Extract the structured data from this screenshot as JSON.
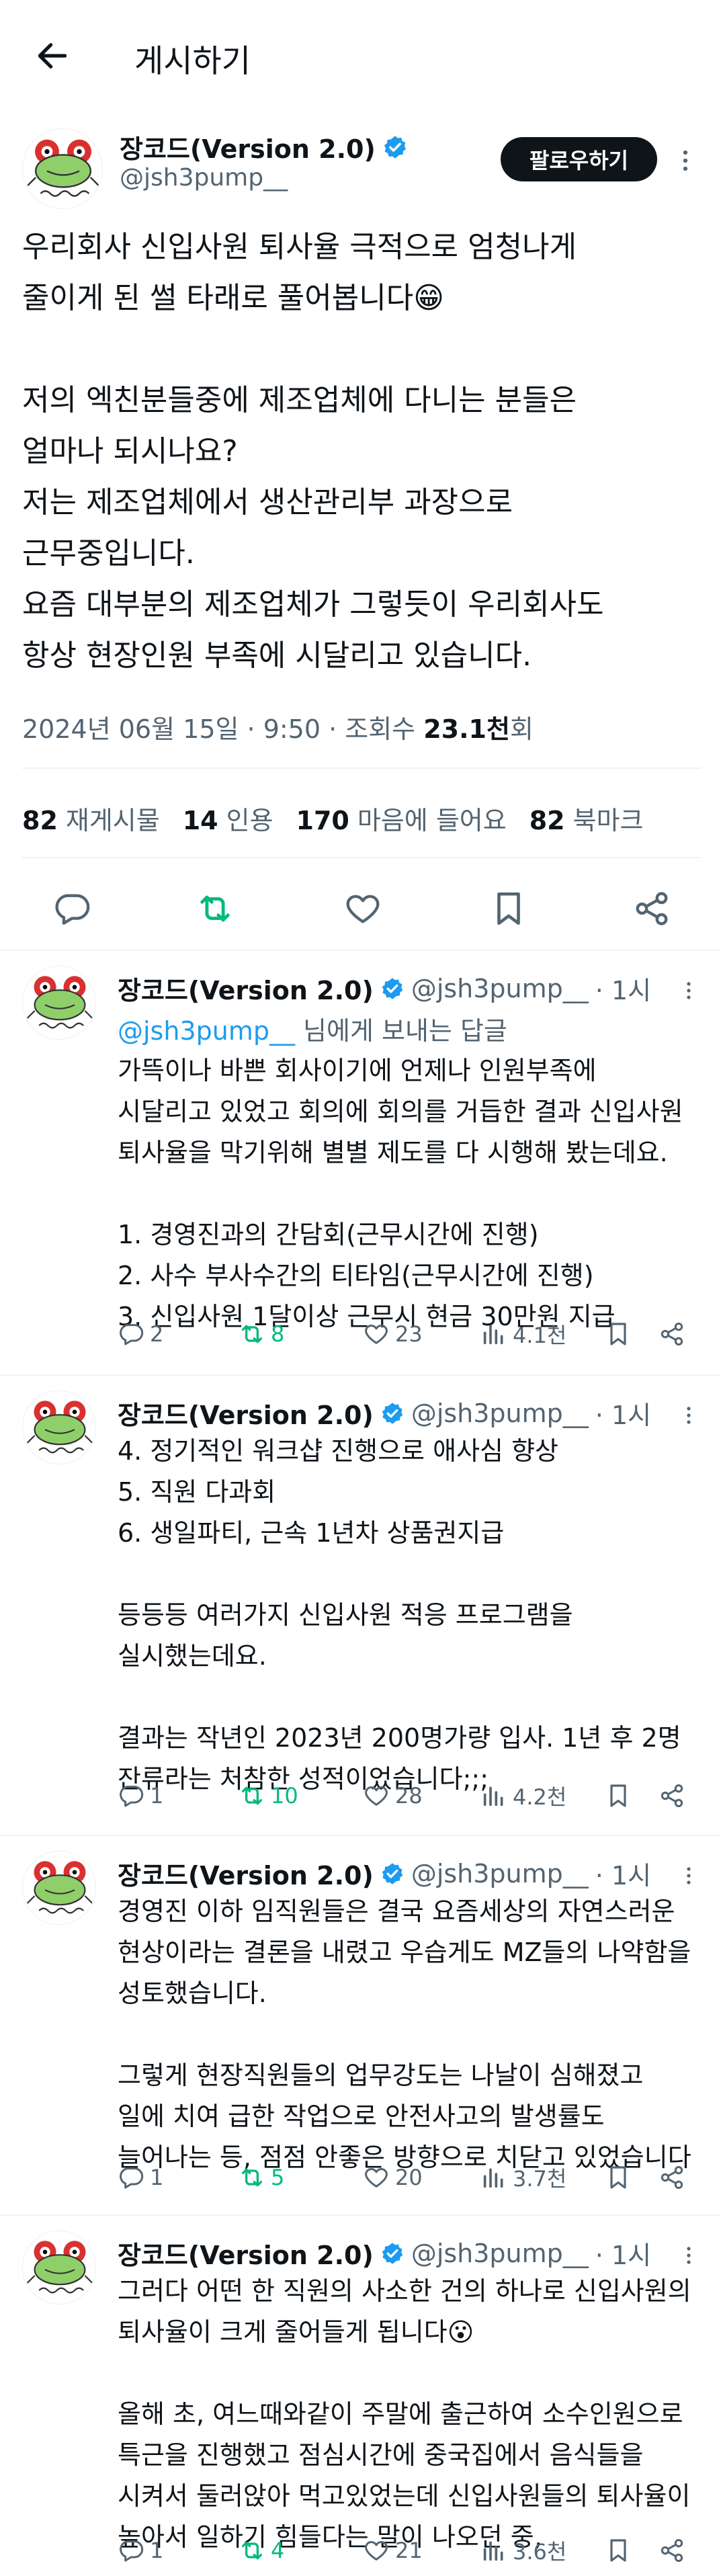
{
  "header": {
    "title": "게시하기"
  },
  "colors": {
    "accent": "#1d9bf0",
    "retweet": "#00ba7c",
    "text": "#0f1419",
    "muted": "#536471"
  },
  "post": {
    "author_name": "장코드(Version 2.0)",
    "handle": "@jsh3pump__",
    "follow_label": "팔로우하기",
    "body": "우리회사 신입사원 퇴사율 극적으로 엄청나게\n줄이게 된 썰 타래로 풀어봅니다😁\n\n저의 엑친분들중에 제조업체에 다니는 분들은\n얼마나 되시나요?\n저는 제조업체에서 생산관리부 과장으로\n근무중입니다.\n요즘 대부분의 제조업체가 그렇듯이 우리회사도\n항상 현장인원 부족에 시달리고 있습니다.",
    "meta_prefix": "2024년 06월 15일 · 9:50 · 조회수 ",
    "views": "23.1천",
    "views_suffix": "회",
    "stats": [
      {
        "count": "82",
        "label": "재게시물"
      },
      {
        "count": "14",
        "label": "인용"
      },
      {
        "count": "170",
        "label": "마음에 들어요"
      },
      {
        "count": "82",
        "label": "북마크"
      }
    ]
  },
  "replies": [
    {
      "name": "장코드(Version 2.0)",
      "handle": "@jsh3pump__",
      "time": "· 1시",
      "reply_to_handle": "@jsh3pump__",
      "reply_to_suffix": " 님에게 보내는 답글",
      "body": "가뜩이나 바쁜 회사이기에 언제나 인원부족에\n시달리고 있었고 회의에 회의를 거듭한 결과 신입사원\n퇴사율을 막기위해 별별 제도를 다 시행해 봤는데요.\n\n1. 경영진과의 간담회(근무시간에 진행)\n2. 사수 부사수간의 티타임(근무시간에 진행)\n3. 신입사원 1달이상 근무시 현금 30만원 지급",
      "replies": "2",
      "reposts": "8",
      "likes": "23",
      "views": "4.1천"
    },
    {
      "name": "장코드(Version 2.0)",
      "handle": "@jsh3pump__",
      "time": "· 1시",
      "body": "4. 정기적인 워크샵 진행으로 애사심 향상\n5. 직원 다과회\n6. 생일파티, 근속 1년차 상품권지급\n\n등등등 여러가지 신입사원 적응 프로그램을\n실시했는데요.\n\n결과는 작년인 2023년 200명가량 입사. 1년 후 2명\n잔류라는 처참한 성적이었습니다;;;",
      "replies": "1",
      "reposts": "10",
      "likes": "28",
      "views": "4.2천"
    },
    {
      "name": "장코드(Version 2.0)",
      "handle": "@jsh3pump__",
      "time": "· 1시",
      "body": "경영진 이하 임직원들은 결국 요즘세상의 자연스러운\n현상이라는 결론을 내렸고 우습게도 MZ들의 나약함을\n성토했습니다.\n\n그렇게 현장직원들의 업무강도는 나날이 심해졌고\n일에 치여 급한 작업으로 안전사고의 발생률도\n늘어나는 등, 점점 안좋은 방향으로 치닫고 있었습니다",
      "replies": "1",
      "reposts": "5",
      "likes": "20",
      "views": "3.7천"
    },
    {
      "name": "장코드(Version 2.0)",
      "handle": "@jsh3pump__",
      "time": "· 1시",
      "body": "그러다 어떤 한 직원의 사소한 건의 하나로 신입사원의\n퇴사율이 크게 줄어들게 됩니다😮\n\n올해 초, 여느때와같이 주말에 출근하여 소수인원으로\n특근을 진행했고 점심시간에 중국집에서 음식들을\n시켜서 둘러앉아 먹고있었는데 신입사원들의 퇴사율이\n높아서 일하기 힘들다는 말이 나오던 중,",
      "replies": "1",
      "reposts": "4",
      "likes": "21",
      "views": "3.6천"
    }
  ],
  "icons": {
    "back": "arrow-left-icon",
    "verified": "verified-badge-icon",
    "more": "more-vertical-icon",
    "reply": "reply-icon",
    "repost": "repost-icon",
    "like": "heart-icon",
    "bookmark": "bookmark-icon",
    "share": "share-icon",
    "views": "views-chart-icon"
  }
}
